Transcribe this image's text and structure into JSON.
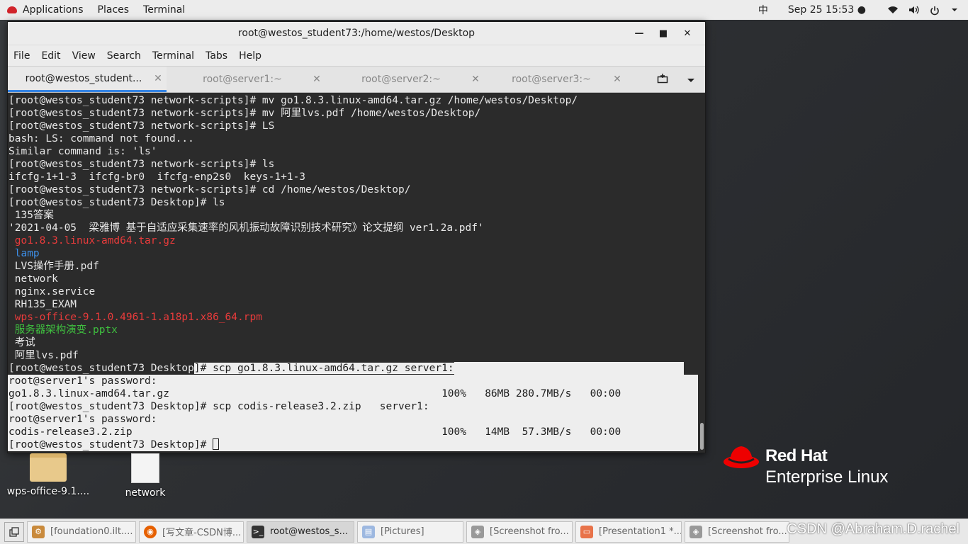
{
  "topbar": {
    "applications": "Applications",
    "places": "Places",
    "terminal": "Terminal",
    "input_method": "中",
    "datetime": "Sep 25  15:53 ●"
  },
  "window": {
    "title": "root@westos_student73:/home/westos/Desktop",
    "minimize": "—",
    "maximize": "■",
    "close": "✕"
  },
  "menubar": [
    "File",
    "Edit",
    "View",
    "Search",
    "Terminal",
    "Tabs",
    "Help"
  ],
  "tabs": [
    {
      "label": "root@westos_student...",
      "close": "✕"
    },
    {
      "label": "root@server1:~",
      "close": "✕"
    },
    {
      "label": "root@server2:~",
      "close": "✕"
    },
    {
      "label": "root@server3:~",
      "close": "✕"
    }
  ],
  "terminal_lines": [
    "[root@westos_student73 network-scripts]# mv go1.8.3.linux-amd64.tar.gz /home/westos/Desktop/",
    "[root@westos_student73 network-scripts]# mv 阿里lvs.pdf /home/westos/Desktop/",
    "[root@westos_student73 network-scripts]# LS",
    "bash: LS: command not found...",
    "Similar command is: 'ls'",
    "[root@westos_student73 network-scripts]# ls",
    "ifcfg-1+1-3  ifcfg-br0  ifcfg-enp2s0  keys-1+1-3",
    "[root@westos_student73 network-scripts]# cd /home/westos/Desktop/",
    "[root@westos_student73 Desktop]# ls",
    " 135答案",
    "'2021-04-05  梁雅博 基于自适应采集速率的风机振动故障识别技术研究》论文提纲 ver1.2a.pdf'",
    " go1.8.3.linux-amd64.tar.gz",
    " lamp",
    " LVS操作手册.pdf",
    " network",
    " nginx.service",
    " RH135_EXAM",
    " wps-office-9.1.0.4961-1.a18p1.x86_64.rpm",
    " 服务器架构演变.pptx",
    " 考试",
    " 阿里lvs.pdf"
  ],
  "terminal_selected_lines": {
    "partial_prefix": "[root@westos_student73 Desktop",
    "partial_rest": "]# scp go1.8.3.linux-amd64.tar.gz server1:",
    "lines": [
      "root@server1's password:",
      "go1.8.3.linux-amd64.tar.gz                                            100%   86MB 280.7MB/s   00:00",
      "[root@westos_student73 Desktop]# scp codis-release3.2.zip   server1:",
      "root@server1's password:",
      "codis-release3.2.zip                                                  100%   14MB  57.3MB/s   00:00",
      "[root@westos_student73 Desktop]# "
    ]
  },
  "desktop_icons": [
    {
      "label": "wps-office-9.1...."
    },
    {
      "label": "network"
    }
  ],
  "redhat": {
    "brand": "Red Hat",
    "product": "Enterprise Linux"
  },
  "taskbar": [
    {
      "label": "[foundation0.ilt...."
    },
    {
      "label": "[写文章-CSDN博..."
    },
    {
      "label": "root@westos_s..."
    },
    {
      "label": "[Pictures]"
    },
    {
      "label": "[Screenshot fro..."
    },
    {
      "label": "[Presentation1 *..."
    },
    {
      "label": "[Screenshot fro..."
    }
  ],
  "watermark": "CSDN @Abraham.D.rachel",
  "colors": {
    "accent": "#3584e4",
    "redhat_red": "#ee0000",
    "ls_red": "#e83b3b",
    "ls_blue": "#3d8fe8",
    "ls_green": "#3fbf3f"
  }
}
